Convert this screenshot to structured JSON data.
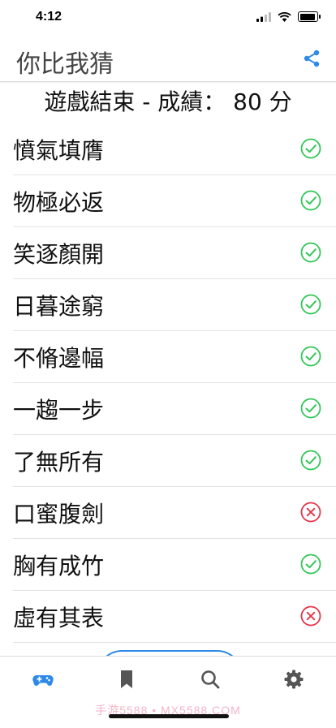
{
  "status_bar": {
    "time": "4:12"
  },
  "header": {
    "title": "你比我猜"
  },
  "result": {
    "title": "遊戲結束 - 成績： 80 分"
  },
  "colors": {
    "correct": "#34c759",
    "wrong": "#e5374b",
    "accent": "#2e8ae6"
  },
  "items": [
    {
      "text": "憤氣填膺",
      "status": "correct"
    },
    {
      "text": "物極必返",
      "status": "correct"
    },
    {
      "text": "笑逐顏開",
      "status": "correct"
    },
    {
      "text": "日暮途窮",
      "status": "correct"
    },
    {
      "text": "不脩邊幅",
      "status": "correct"
    },
    {
      "text": "一趨一步",
      "status": "correct"
    },
    {
      "text": "了無所有",
      "status": "correct"
    },
    {
      "text": "口蜜腹劍",
      "status": "wrong"
    },
    {
      "text": "胸有成竹",
      "status": "correct"
    },
    {
      "text": "虛有其表",
      "status": "wrong"
    }
  ],
  "tabs": [
    {
      "icon": "gamepad-icon",
      "active": true
    },
    {
      "icon": "bookmark-icon",
      "active": false
    },
    {
      "icon": "search-icon",
      "active": false
    },
    {
      "icon": "gear-icon",
      "active": false
    }
  ],
  "watermark": "手游5588 • MX5588.COM"
}
